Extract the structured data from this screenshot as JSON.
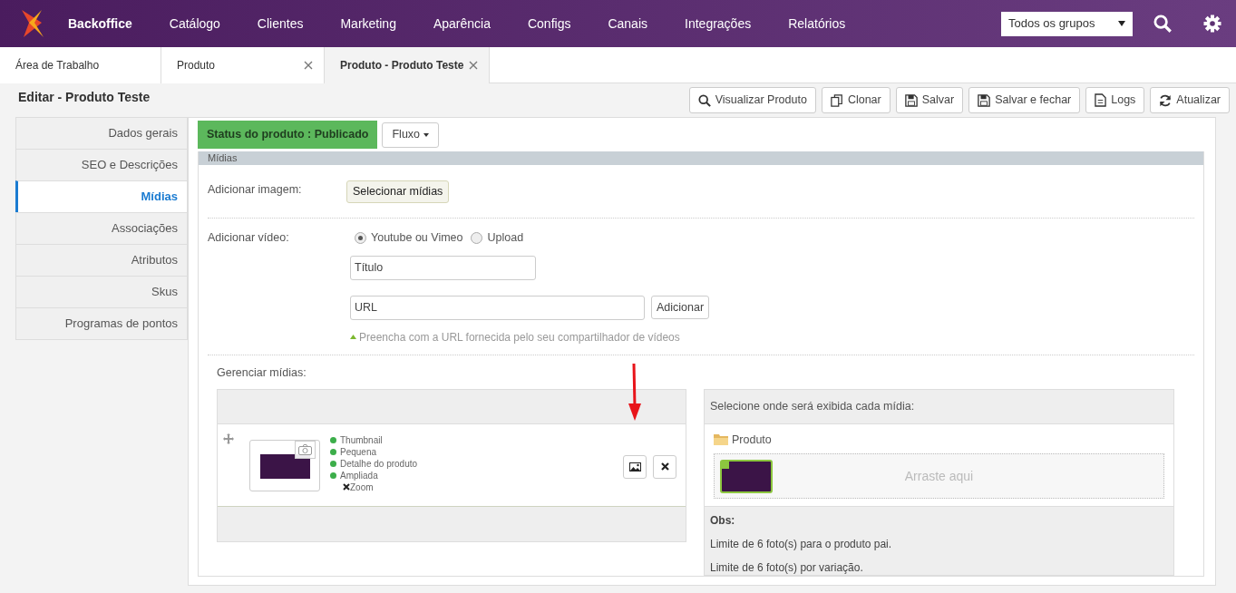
{
  "nav": {
    "brand": "Backoffice",
    "items": [
      "Catálogo",
      "Clientes",
      "Marketing",
      "Aparência",
      "Configs",
      "Canais",
      "Integrações",
      "Relatórios"
    ],
    "group_select": "Todos os grupos"
  },
  "tabs": [
    {
      "label": "Área de Trabalho",
      "selected": false,
      "closable": false
    },
    {
      "label": "Produto",
      "selected": false,
      "closable": true
    },
    {
      "label": "Produto - Produto Teste",
      "selected": true,
      "closable": true
    }
  ],
  "page_title": "Editar - Produto Teste",
  "toolbar": [
    {
      "kind": "search",
      "label": "Visualizar Produto"
    },
    {
      "kind": "copy",
      "label": "Clonar"
    },
    {
      "kind": "save",
      "label": "Salvar"
    },
    {
      "kind": "save",
      "label": "Salvar e fechar"
    },
    {
      "kind": "file",
      "label": "Logs"
    },
    {
      "kind": "refresh",
      "label": "Atualizar"
    }
  ],
  "sidebar": [
    {
      "label": "Dados gerais",
      "selected": false
    },
    {
      "label": "SEO e Descrições",
      "selected": false
    },
    {
      "label": "Mídias",
      "selected": true
    },
    {
      "label": "Associações",
      "selected": false
    },
    {
      "label": "Atributos",
      "selected": false
    },
    {
      "label": "Skus",
      "selected": false
    },
    {
      "label": "Programas de pontos",
      "selected": false
    }
  ],
  "status_badge": "Status do produto : Publicado",
  "flow_button": "Fluxo",
  "section_title": "Mídias",
  "add_image": {
    "label": "Adicionar imagem:",
    "button": "Selecionar mídias"
  },
  "add_video": {
    "label": "Adicionar vídeo:",
    "options": [
      {
        "label": "Youtube ou Vimeo",
        "selected": true
      },
      {
        "label": "Upload",
        "selected": false
      }
    ],
    "title_field": {
      "placeholder": "Título"
    },
    "url_field": {
      "placeholder": "URL"
    },
    "add_button": "Adicionar",
    "hint": "Preencha com a URL fornecida pelo seu compartilhador de vídeos"
  },
  "manage": {
    "label": "Gerenciar mídias:",
    "formats": [
      {
        "label": "Thumbnail",
        "on": true
      },
      {
        "label": "Pequena",
        "on": true
      },
      {
        "label": "Detalhe do produto",
        "on": true
      },
      {
        "label": "Ampliada",
        "on": true
      },
      {
        "label": "Zoom",
        "on": false
      }
    ]
  },
  "display": {
    "header": "Selecione onde será exibida cada mídia:",
    "folder": "Produto",
    "drop_hint": "Arraste aqui",
    "obs_title": "Obs:",
    "notes": [
      "Limite de 6 foto(s) para o produto pai.",
      "Limite de 6 foto(s) por variação."
    ]
  }
}
